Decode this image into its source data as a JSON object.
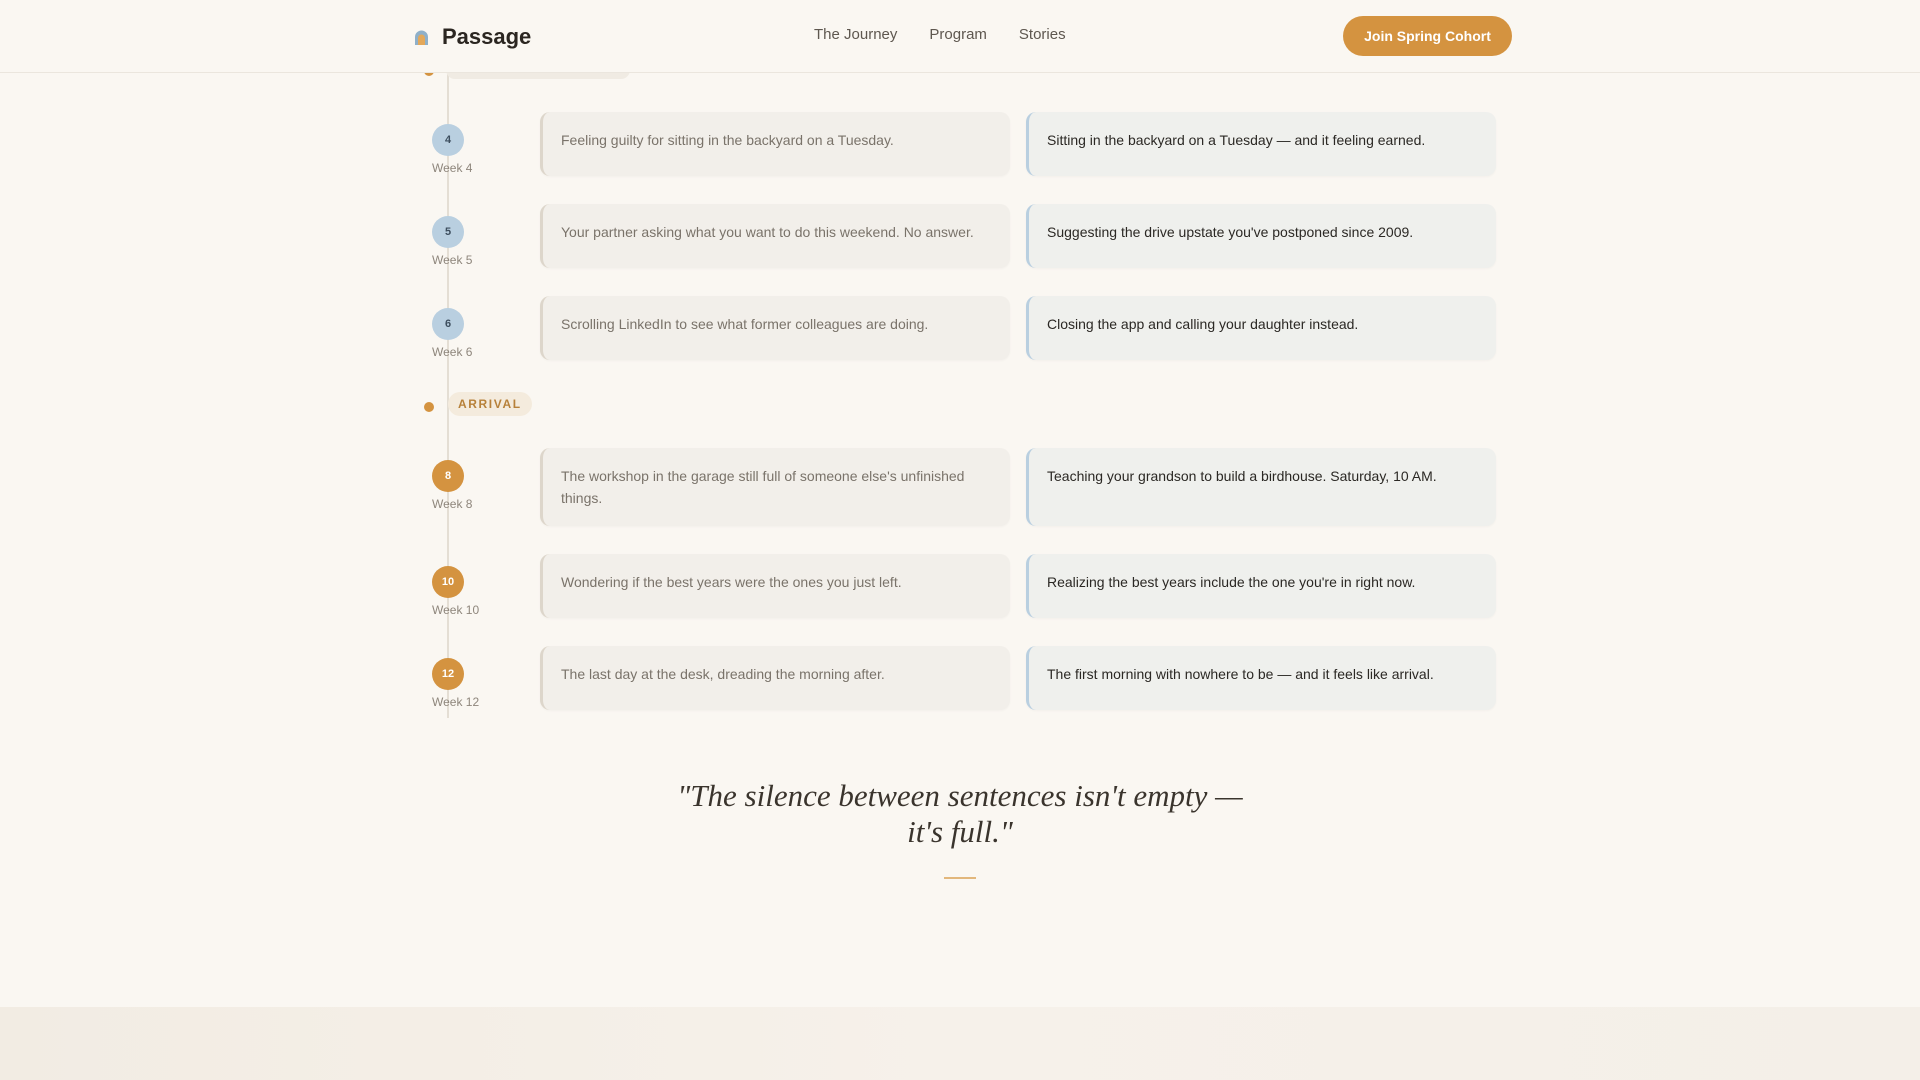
{
  "header": {
    "brand": "Passage",
    "nav": [
      "The Journey",
      "Program",
      "Stories"
    ],
    "cta": "Join Spring Cohort"
  },
  "timeline": {
    "phase_label": "ARRIVAL",
    "rows": [
      {
        "num": "4",
        "week": "Week 4",
        "style": "blue",
        "before": "Feeling guilty for sitting in the backyard on a Tuesday.",
        "after": "Sitting in the backyard on a Tuesday — and it feeling earned."
      },
      {
        "num": "5",
        "week": "Week 5",
        "style": "blue",
        "before": "Your partner asking what you want to do this weekend. No answer.",
        "after": "Suggesting the drive upstate you've postponed since 2009."
      },
      {
        "num": "6",
        "week": "Week 6",
        "style": "blue",
        "before": "Scrolling LinkedIn to see what former colleagues are doing.",
        "after": "Closing the app and calling your daughter instead."
      },
      {
        "num": "8",
        "week": "Week 8",
        "style": "gold",
        "before": "The workshop in the garage still full of someone else's unfinished things.",
        "after": "Teaching your grandson to build a birdhouse. Saturday, 10 AM."
      },
      {
        "num": "10",
        "week": "Week 10",
        "style": "gold",
        "before": "Wondering if the best years were the ones you just left.",
        "after": "Realizing the best years include the one you're in right now."
      },
      {
        "num": "12",
        "week": "Week 12",
        "style": "gold",
        "before": "The last day at the desk, dreading the morning after.",
        "after": "The first morning with nowhere to be — and it feels like arrival."
      }
    ]
  },
  "quote": "\"The silence between sentences isn't empty — it's full.\"",
  "colors": {
    "accent": "#d49340",
    "blue_node": "#b9cfe0",
    "background": "#faf7f2"
  }
}
